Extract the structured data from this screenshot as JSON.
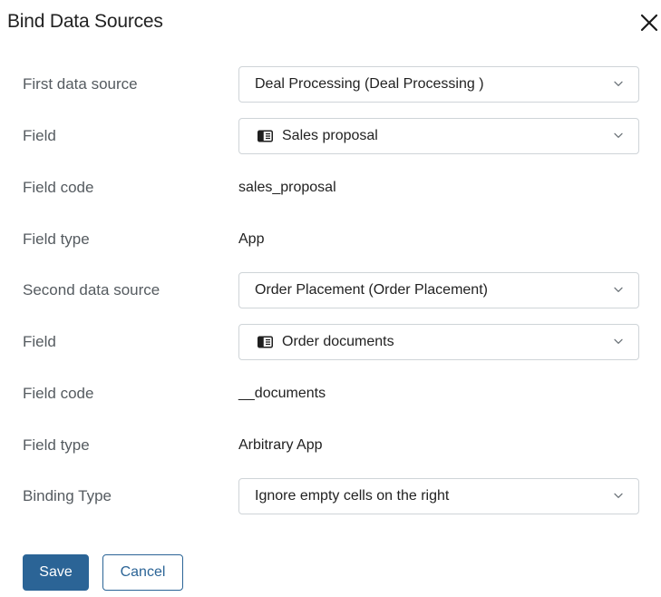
{
  "dialog": {
    "title": "Bind Data Sources",
    "close_icon": "close-icon"
  },
  "rows": {
    "first_source": {
      "label": "First data source",
      "value": "Deal Processing (Deal Processing )"
    },
    "first_field": {
      "label": "Field",
      "value": "Sales proposal",
      "icon": "app-icon"
    },
    "first_code": {
      "label": "Field code",
      "value": "sales_proposal"
    },
    "first_type": {
      "label": "Field type",
      "value": "App"
    },
    "second_source": {
      "label": "Second data source",
      "value": "Order Placement (Order Placement)"
    },
    "second_field": {
      "label": "Field",
      "value": "Order documents",
      "icon": "app-icon"
    },
    "second_code": {
      "label": "Field code",
      "value": "__documents"
    },
    "second_type": {
      "label": "Field type",
      "value": "Arbitrary App"
    },
    "binding_type": {
      "label": "Binding Type",
      "value": "Ignore empty cells on the right"
    }
  },
  "buttons": {
    "save": "Save",
    "cancel": "Cancel"
  },
  "colors": {
    "primary": "#2b6496",
    "border": "#cfd4d8",
    "label": "#555b60",
    "text": "#222222"
  }
}
